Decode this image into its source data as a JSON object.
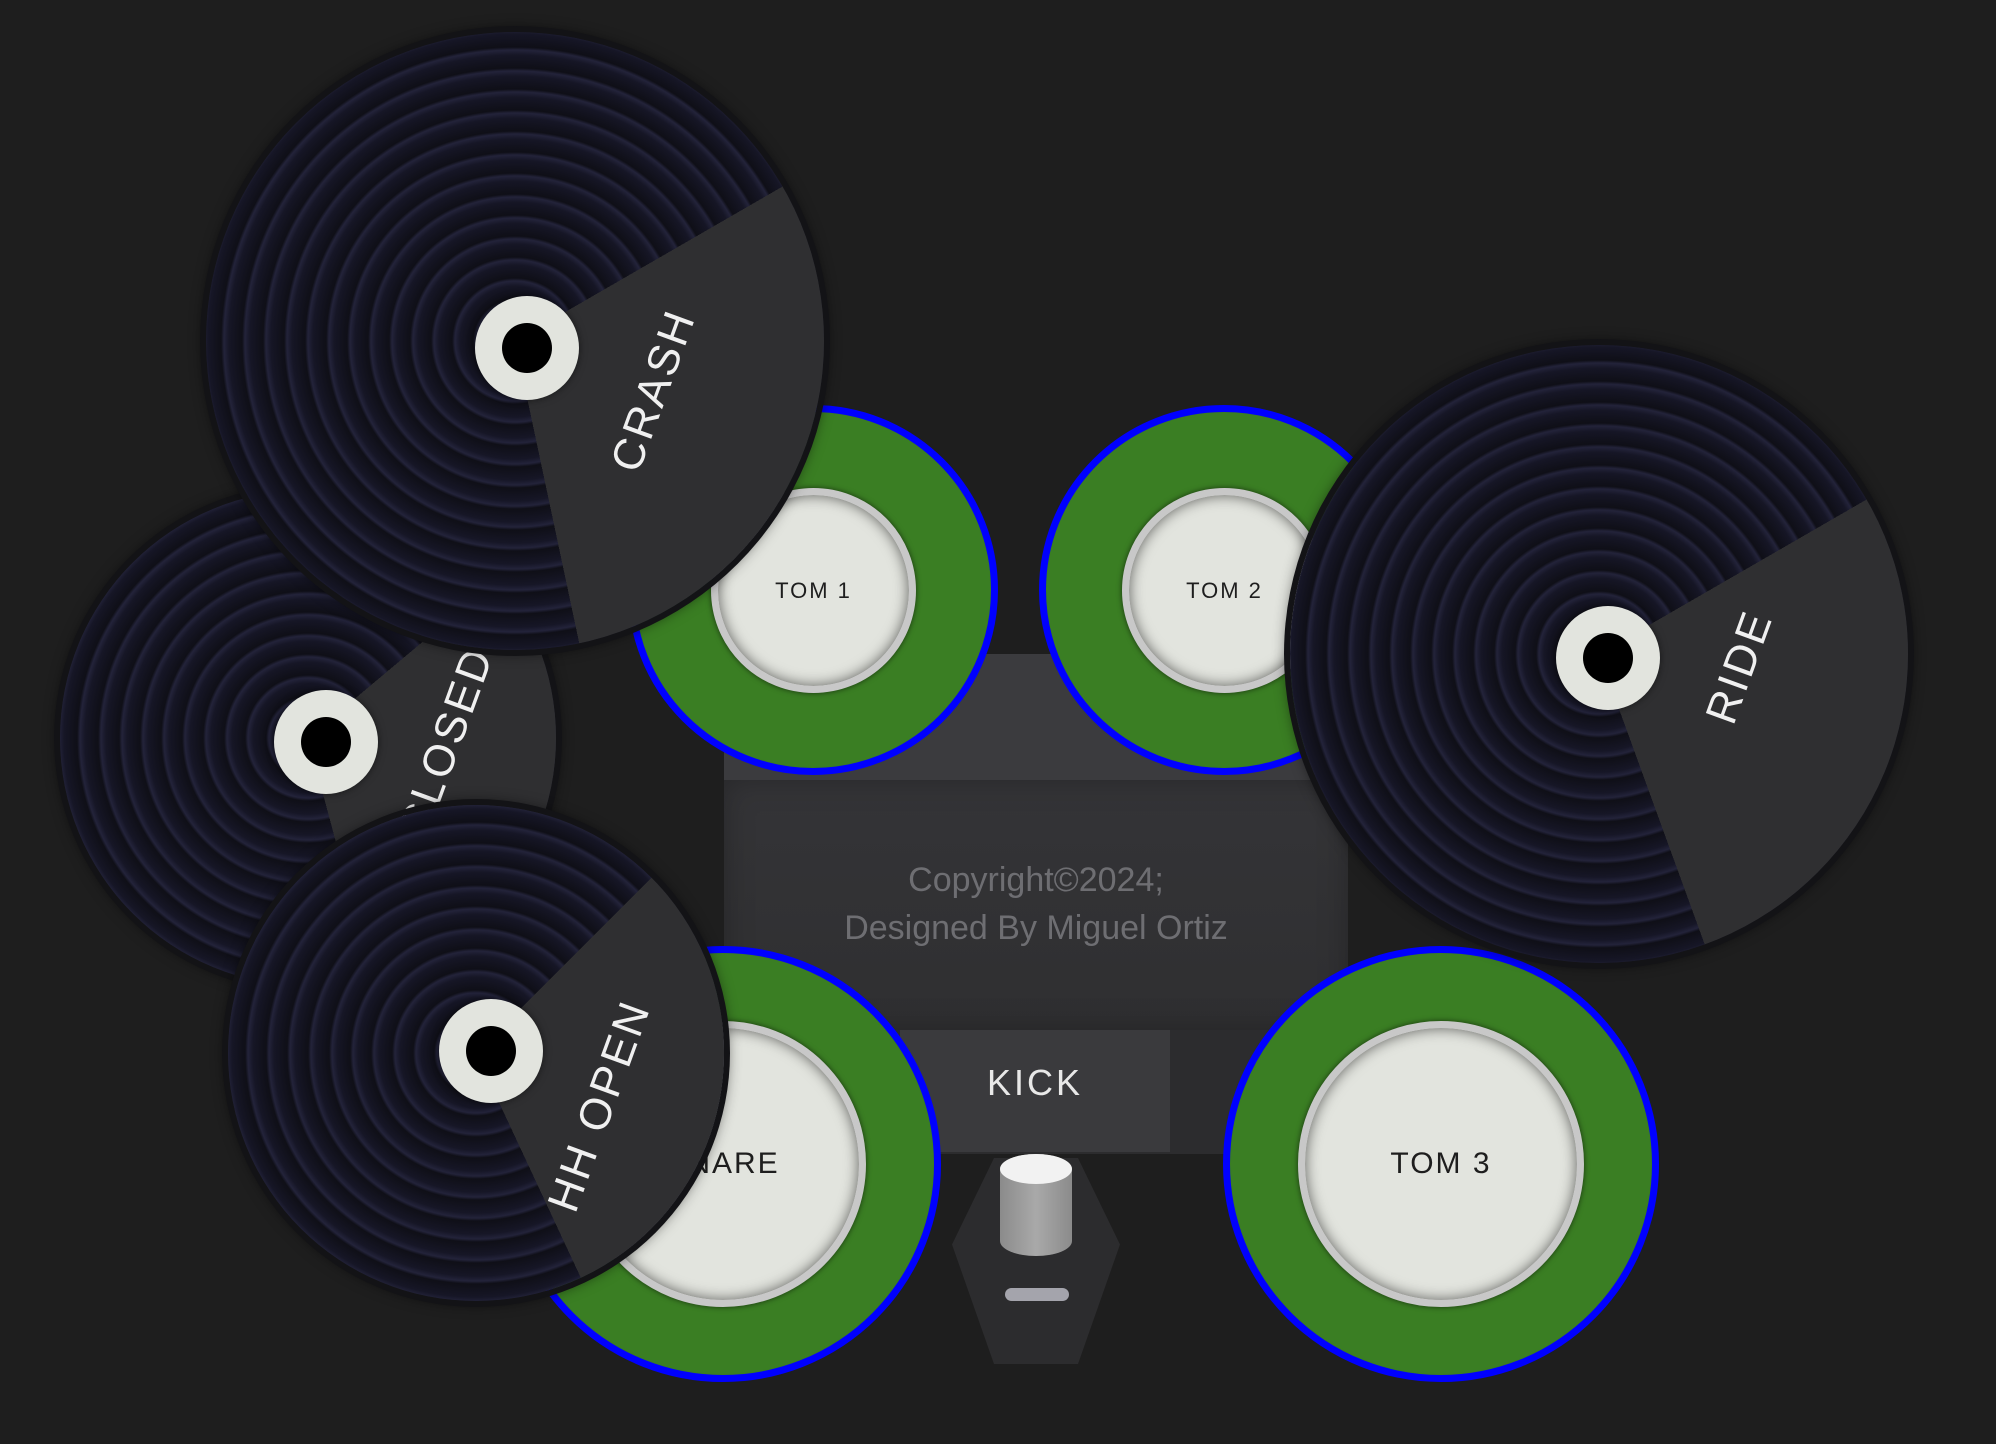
{
  "copyright": {
    "line1": "Copyright©2024;",
    "line2": "Designed By Miguel Ortiz"
  },
  "kick": {
    "label": "KICK"
  },
  "drums": {
    "tom1": {
      "label": "TOM 1"
    },
    "tom2": {
      "label": "TOM 2"
    },
    "tom3": {
      "label": "TOM 3"
    },
    "snare": {
      "label": "SNARE"
    }
  },
  "cymbals": {
    "crash": {
      "label": "CRASH"
    },
    "ride": {
      "label": "RIDE"
    },
    "hh_closed": {
      "label": "HH CLOSED"
    },
    "hh_open": {
      "label": "HH OPEN"
    }
  },
  "colors": {
    "background": "#1e1e1e",
    "drum_ring": "#0000ff",
    "drum_shell": "#3a7e23",
    "drum_head": "#e2e4de",
    "cymbal_wedge": "#2f2f31"
  },
  "icons": {
    "kick_pedal": "kick-pedal-icon"
  }
}
